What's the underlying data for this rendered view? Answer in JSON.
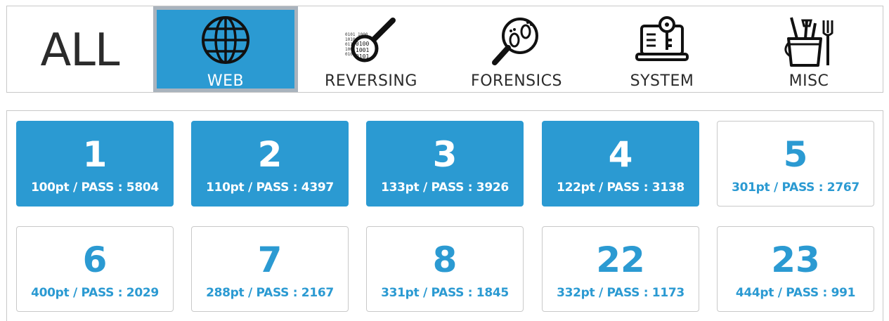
{
  "categories": {
    "all": {
      "label": "ALL"
    },
    "items": [
      {
        "label": "WEB",
        "icon": "globe-icon",
        "active": true
      },
      {
        "label": "REVERSING",
        "icon": "binary-magnifier-icon",
        "active": false
      },
      {
        "label": "FORENSICS",
        "icon": "footprint-magnifier-icon",
        "active": false
      },
      {
        "label": "SYSTEM",
        "icon": "laptop-key-icon",
        "active": false
      },
      {
        "label": "MISC",
        "icon": "toolbox-bucket-icon",
        "active": false
      }
    ]
  },
  "colors": {
    "accent": "#2b9ad2",
    "active_border": "#a9b3bd",
    "card_border": "#c9c9c9",
    "text_dark": "#2b2b2b"
  },
  "challenges": [
    {
      "number": "1",
      "info": "100pt / PASS : 5804",
      "solved": true
    },
    {
      "number": "2",
      "info": "110pt / PASS : 4397",
      "solved": true
    },
    {
      "number": "3",
      "info": "133pt / PASS : 3926",
      "solved": true
    },
    {
      "number": "4",
      "info": "122pt / PASS : 3138",
      "solved": true
    },
    {
      "number": "5",
      "info": "301pt / PASS : 2767",
      "solved": false
    },
    {
      "number": "6",
      "info": "400pt / PASS : 2029",
      "solved": false
    },
    {
      "number": "7",
      "info": "288pt / PASS : 2167",
      "solved": false
    },
    {
      "number": "8",
      "info": "331pt / PASS : 1845",
      "solved": false
    },
    {
      "number": "22",
      "info": "332pt / PASS : 1173",
      "solved": false
    },
    {
      "number": "23",
      "info": "444pt / PASS : 991",
      "solved": false
    }
  ]
}
